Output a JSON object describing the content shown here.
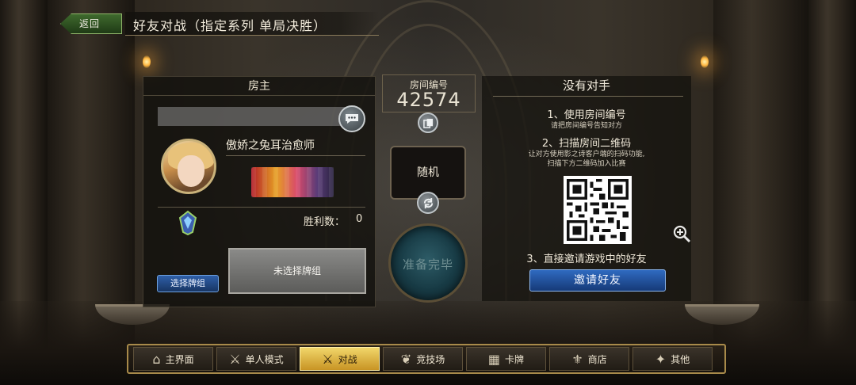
{
  "header": {
    "back_label": "返回",
    "title": "好友对战（指定系列 单局决胜）"
  },
  "host": {
    "panel_title": "房主",
    "player_name": "傲娇之兔耳治愈师",
    "wins_label": "胜利数：",
    "wins_value": "0",
    "select_deck_label": "选择牌组",
    "deck_placeholder": "未选择牌组"
  },
  "room": {
    "label": "房间编号",
    "number": "42574",
    "mode_label": "随机",
    "ready_label": "准备完毕"
  },
  "opponent": {
    "title": "没有对手",
    "step1_title": "1、使用房间编号",
    "step1_desc": "请把房间编号告知对方",
    "step2_title": "2、扫描房间二维码",
    "step2_desc_line1": "让对方使用影之诗客户端的扫码功能,",
    "step2_desc_line2": "扫描下方二维码加入比赛",
    "step3_title": "3、直接邀请游戏中的好友",
    "invite_label": "邀请好友"
  },
  "nav": {
    "items": [
      {
        "label": "主界面",
        "icon": "home-icon",
        "glyph": "⌂"
      },
      {
        "label": "单人模式",
        "icon": "sword-icon",
        "glyph": "⚔"
      },
      {
        "label": "对战",
        "icon": "crossed-swords-icon",
        "glyph": "⚔"
      },
      {
        "label": "竞技场",
        "icon": "laurel-icon",
        "glyph": "❦"
      },
      {
        "label": "卡牌",
        "icon": "cards-icon",
        "glyph": "▦"
      },
      {
        "label": "商店",
        "icon": "shop-icon",
        "glyph": "⚜"
      },
      {
        "label": "其他",
        "icon": "more-icon",
        "glyph": "✦"
      }
    ],
    "active_index": 2
  },
  "colors": {
    "accent_blue": "#2f6ac0",
    "active_gold": "#e0b544",
    "back_green": "#3f6a2e"
  }
}
